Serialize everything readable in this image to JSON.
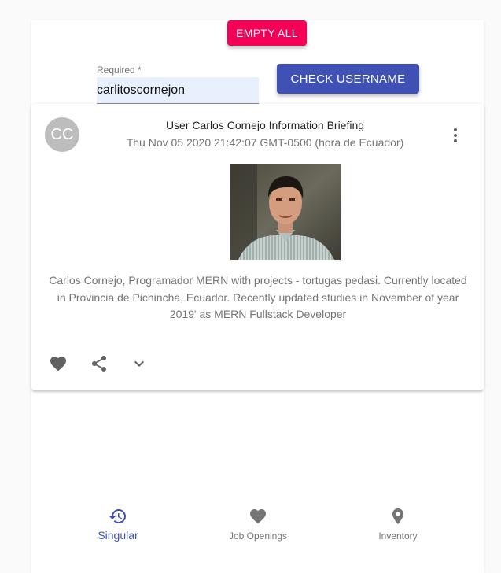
{
  "toolbar": {
    "empty_label": "EMPTY ALL",
    "check_label": "CHECK USERNAME"
  },
  "username_field": {
    "label": "Required *",
    "value": "carlitoscornejon"
  },
  "card": {
    "avatar_initials": "CC",
    "title": "User Carlos Cornejo Information Briefing",
    "subheader": "Thu Nov 05 2020 21:42:07 GMT-0500 (hora de Ecuador)",
    "description": "Carlos Cornejo, Programador MERN with projects - tortugas pedasi. Currently located in Provincia de Pichincha, Ecuador. Recently updated studies in November of year 2019' as MERN Fullstack Developer",
    "actions": {
      "favorite_icon": "heart-icon",
      "share_icon": "share-icon",
      "expand_icon": "chevron-down-icon"
    }
  },
  "bottom_nav": {
    "items": [
      {
        "label": "Singular",
        "icon": "history-icon",
        "active": true
      },
      {
        "label": "Job Openings",
        "icon": "heart-icon",
        "active": false
      },
      {
        "label": "Inventory",
        "icon": "location-pin-icon",
        "active": false
      }
    ]
  },
  "colors": {
    "primary": "#3f51b5",
    "secondary": "#f50057",
    "avatar_bg": "#bdbdbd",
    "autofill_bg": "#e8f0fe",
    "icon_grey": "#757575"
  }
}
